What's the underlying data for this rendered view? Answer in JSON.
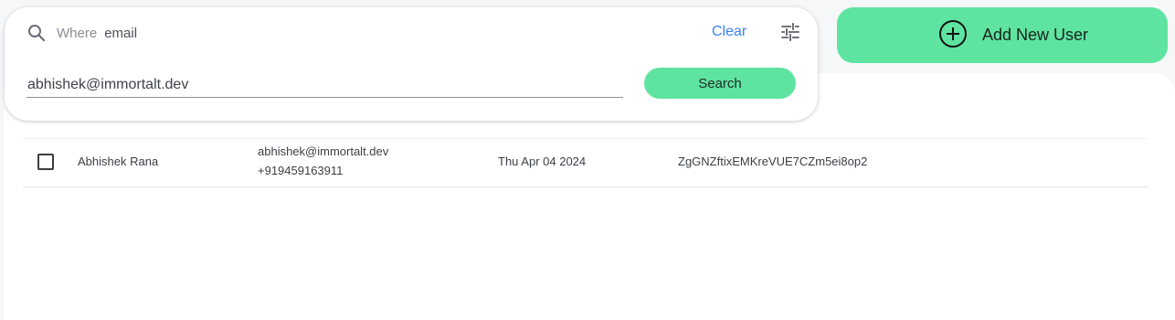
{
  "search": {
    "where_label": "Where",
    "field": "email",
    "clear_label": "Clear",
    "value": "abhishek@immortalt.dev",
    "button_label": "Search"
  },
  "actions": {
    "add_user_label": "Add New User"
  },
  "users": [
    {
      "name": "Abhishek Rana",
      "email": "abhishek@immortalt.dev",
      "phone": "+919459163911",
      "created": "Thu Apr 04 2024",
      "uid": "ZgGNZftixEMKreVUE7CZm5ei8op2"
    }
  ],
  "colors": {
    "accent": "#5ee4a0",
    "link": "#3b82f6",
    "background": "#f6f7f8"
  },
  "icons": [
    "search-icon",
    "tune-icon",
    "add-circle-icon",
    "checkbox-icon"
  ]
}
